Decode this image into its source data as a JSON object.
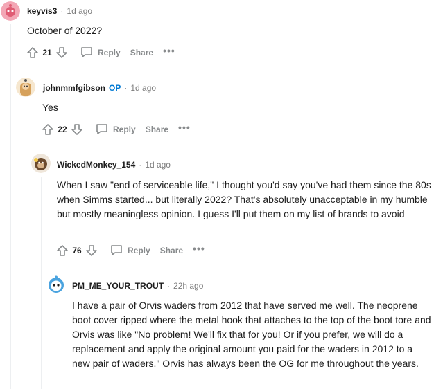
{
  "comments": [
    {
      "username": "keyvis3",
      "op_badge": "",
      "separator": "·",
      "time": "1d ago",
      "body": "October of 2022?",
      "score": "21",
      "reply_label": "Reply",
      "share_label": "Share",
      "more_label": "•••",
      "avatar_color": "#f3a7b5"
    },
    {
      "username": "johnmmfgibson",
      "op_badge": "OP",
      "separator": "·",
      "time": "1d ago",
      "body": "Yes",
      "score": "22",
      "reply_label": "Reply",
      "share_label": "Share",
      "more_label": "•••",
      "avatar_color": "#d6a15b"
    },
    {
      "username": "WickedMonkey_154",
      "op_badge": "",
      "separator": "·",
      "time": "1d ago",
      "body": "When I saw \"end of serviceable life,\" I thought you'd say you've had them since the 80s when Simms started... but literally 2022? That's absolutely unacceptable in my humble but mostly meaningless opinion. I guess I'll put them on my list of brands to avoid",
      "score": "76",
      "reply_label": "Reply",
      "share_label": "Share",
      "more_label": "•••",
      "avatar_color": "#6b4a2e"
    },
    {
      "username": "PM_ME_YOUR_TROUT",
      "op_badge": "",
      "separator": "·",
      "time": "22h ago",
      "body": "I have a pair of Orvis waders from 2012 that have served me well. The neoprene boot cover ripped where the metal hook that attaches to the top of the boot tore and Orvis was like \"No problem! We'll fix that for you! Or if you prefer, we will do a replacement and apply the original amount you paid for the waders in 2012 to a new pair of waders.\" Orvis has always been the OG for me throughout the years.",
      "avatar_color": "#4aa3df"
    }
  ],
  "colors": {
    "op_badge": "#0079d3",
    "meta_text": "#7c7c7c",
    "action_text": "#878a8c",
    "thread_line": "#edeff1"
  },
  "icons": [
    "upvote-icon",
    "downvote-icon",
    "reply-bubble-icon",
    "more-icon"
  ]
}
